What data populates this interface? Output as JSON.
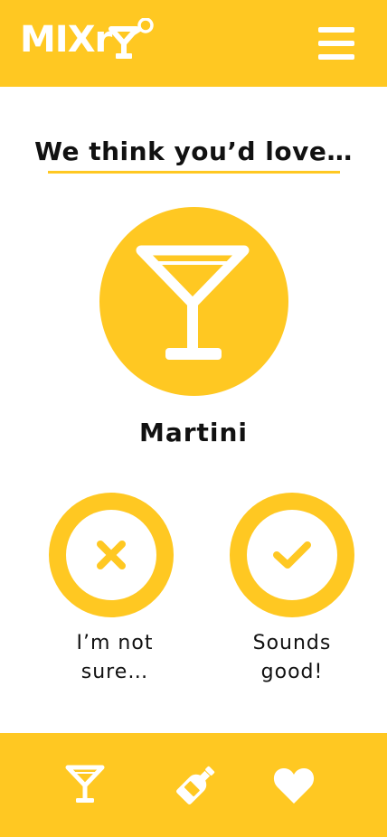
{
  "brand": {
    "logo_text": "MIXr",
    "color_accent": "#FFC822",
    "color_text": "#111111",
    "color_icon": "#FFFFFF"
  },
  "header": {
    "menu_icon": "hamburger-menu-icon"
  },
  "main": {
    "heading": "We think you’d love…",
    "drink_icon": "cocktail-glass-icon",
    "drink_name": "Martini"
  },
  "choices": {
    "reject": {
      "icon": "close-x-icon",
      "label_line1": "I’m not",
      "label_line2": "sure…"
    },
    "accept": {
      "icon": "checkmark-icon",
      "label_line1": "Sounds",
      "label_line2": "good!"
    }
  },
  "footer": {
    "nav": [
      {
        "icon": "cocktail-glass-icon"
      },
      {
        "icon": "bottle-icon"
      },
      {
        "icon": "heart-icon"
      }
    ]
  }
}
